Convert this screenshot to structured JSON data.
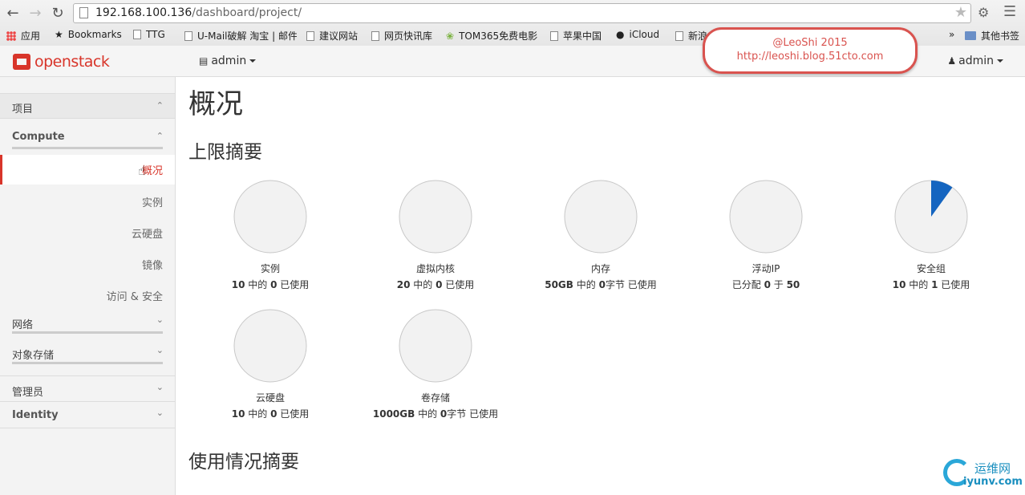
{
  "browser": {
    "url_host": "192.168.100.136",
    "url_path": "/dashboard/project/",
    "bookmarks": [
      {
        "label": "应用",
        "icon": "apps-icon"
      },
      {
        "label": "Bookmarks",
        "icon": "star-icon"
      },
      {
        "label": "TTG",
        "icon": "page-icon"
      },
      {
        "label": "U-Mail破解 淘宝 | 邮件",
        "icon": "page-icon"
      },
      {
        "label": "建议网站",
        "icon": "page-icon"
      },
      {
        "label": "网页快讯库",
        "icon": "page-icon"
      },
      {
        "label": "TOM365免费电影",
        "icon": "leaf-icon"
      },
      {
        "label": "苹果中国",
        "icon": "page-icon"
      },
      {
        "label": "iCloud",
        "icon": "apple-icon"
      },
      {
        "label": "新浪",
        "icon": "page-icon"
      }
    ],
    "overflow": "»",
    "other_bookmarks": "其他书签"
  },
  "header": {
    "logo_text": "openstack",
    "project_menu": "admin",
    "user_menu": "admin"
  },
  "watermark": {
    "line1": "@LeoShi 2015",
    "line2": "http://leoshi.blog.51cto.com"
  },
  "sidebar": {
    "project_label": "项目",
    "compute_label": "Compute",
    "items": [
      "概况",
      "实例",
      "云硬盘",
      "镜像",
      "访问 & 安全"
    ],
    "network_label": "网络",
    "object_storage_label": "对象存储",
    "admin_label": "管理员",
    "identity_label": "Identity"
  },
  "main": {
    "title": "概况",
    "limit_summary_title": "上限摘要",
    "usage_summary_title": "使用情况摘要",
    "pies": [
      {
        "name": "实例",
        "total": "10",
        "mid": " 中的 ",
        "used": "0",
        "tail": " 已使用",
        "fraction": 0.0
      },
      {
        "name": "虚拟内核",
        "total": "20",
        "mid": " 中的 ",
        "used": "0",
        "tail": " 已使用",
        "fraction": 0.0
      },
      {
        "name": "内存",
        "total": "50GB",
        "mid": " 中的 ",
        "used": "0",
        "tail": "字节 已使用",
        "fraction": 0.0
      },
      {
        "name": "浮动IP",
        "total": "已分配 ",
        "mid": "0",
        "used": " 于 ",
        "tail": "50",
        "fraction": 0.0
      },
      {
        "name": "安全组",
        "total": "10",
        "mid": " 中的 ",
        "used": "1",
        "tail": " 已使用",
        "fraction": 0.1
      },
      {
        "name": "云硬盘",
        "total": "10",
        "mid": " 中的 ",
        "used": "0",
        "tail": " 已使用",
        "fraction": 0.0
      },
      {
        "name": "卷存储",
        "total": "1000GB",
        "mid": " 中的 ",
        "used": "0",
        "tail": "字节 已使用",
        "fraction": 0.0
      }
    ],
    "pie_fill_color": "#1565c0",
    "pie_bg_color": "#f2f2f2"
  },
  "site_logo": {
    "text1": "运维网",
    "text2": "iyunv.com"
  }
}
